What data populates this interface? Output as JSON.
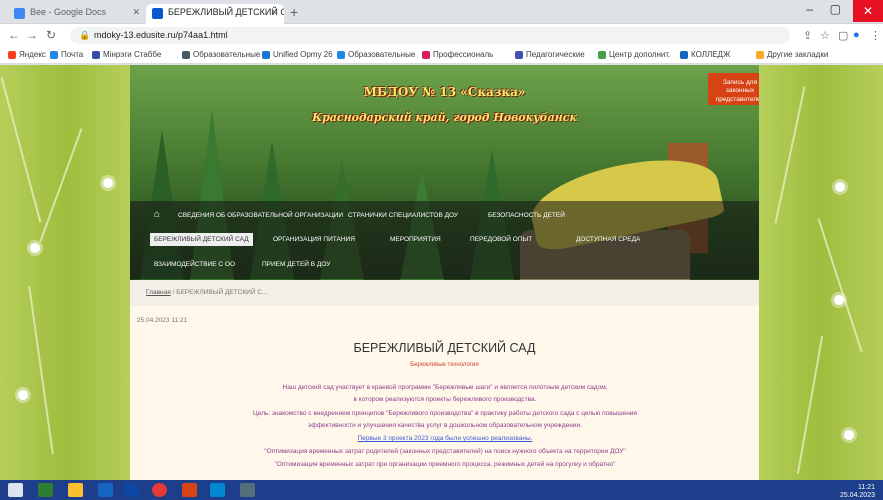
{
  "browser": {
    "tabs": [
      {
        "label": "Bee - Google Docs",
        "active": false
      },
      {
        "label": "БЕРЕЖЛИВЫЙ ДЕТСКИЙ САД",
        "active": true
      }
    ],
    "url": "mdoky-13.edusite.ru/p74aa1.html",
    "bookmarks": [
      "Яндекс",
      "Почта",
      "Мiнрэги Стаббе",
      "Образовательные",
      "Unified Opmy 26",
      "Образовательные",
      "Профессиональ",
      "Педагогические",
      "Центр дополнит.",
      "КОЛЛЕДЖ",
      "Другие закладки"
    ],
    "minimize": "–",
    "maximize": "▢",
    "close": "✕"
  },
  "site": {
    "title_line1": "МБДОУ № 13 «Сказка»",
    "title_line2": "Краснодарский край, город Новокубанск",
    "cta": "Запись для законных представителей",
    "nav": [
      "СВЕДЕНИЯ ОБ ОБРАЗОВАТЕЛЬНОЙ ОРГАНИЗАЦИИ",
      "СТРАНИЧКИ СПЕЦИАЛИСТОВ ДОУ",
      "БЕЗОПАСНОСТЬ ДЕТЕЙ",
      "БЕРЕЖЛИВЫЙ ДЕТСКИЙ САД",
      "ОРГАНИЗАЦИЯ ПИТАНИЯ",
      "МЕРОПРИЯТИЯ",
      "ПЕРЕДОВОЙ ОПЫТ",
      "ДОСТУПНАЯ СРЕДА",
      "ВЗАИМОДЕЙСТВИЕ С ОО",
      "ПРИЕМ ДЕТЕЙ В ДОУ"
    ],
    "breadcrumb_home": "Главная",
    "breadcrumb_current": "БЕРЕЖЛИВЫЙ ДЕТСКИЙ С...",
    "date": "25.04.2023 11:21",
    "page_title": "БЕРЕЖЛИВЫЙ ДЕТСКИЙ САД",
    "page_subtitle": "Бережливые технологии",
    "paragraphs": [
      "Наш детский сад участвует в краевой программе \"Бережливые шаги\" и является пилотным детским садом,",
      "в котором реализуются проекты бережливого производства.",
      "Цель: знакомство с внедрением принципов \"Бережливого производства\" в практику работы детского сада с целью повышения",
      "эффективности и улучшения качества услуг в дошкольном образовательном учреждении.",
      "Первые 3 проекта 2023 года были успешно реализованы.",
      "\"Оптимизация временных затрат родителей (законных представителей) на поиск нужного объекта на территории ДОУ\"",
      "\"Оптимизация временных затрат при организации приемного процесса, режимных детей на прогулку и обратно\""
    ]
  },
  "taskbar": {
    "time": "11:21",
    "date": "25.04.2023"
  },
  "colors": {
    "side_green": "#a9c44a",
    "banner_green": "#4b7e33",
    "cta_red": "#d84315",
    "text_purple": "#8e3e8e",
    "taskbar_blue": "#1d3e8a"
  }
}
